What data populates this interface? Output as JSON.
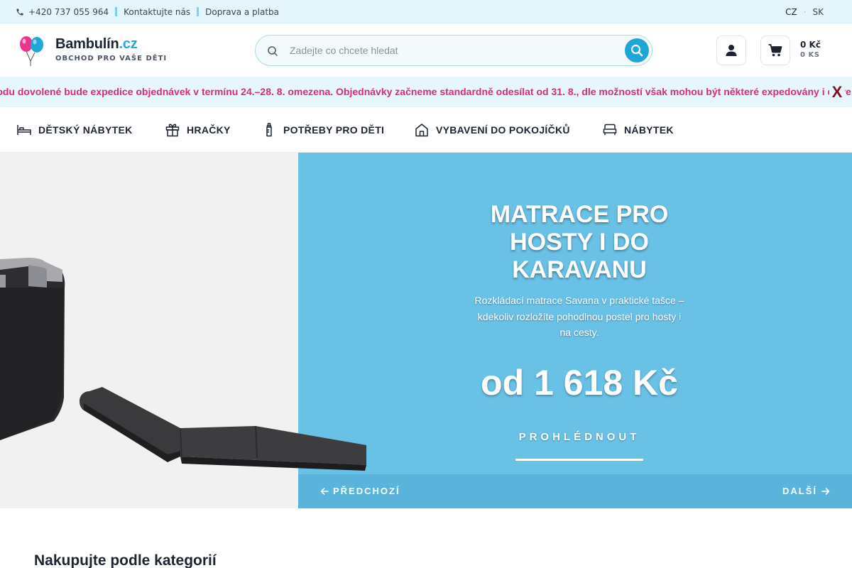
{
  "topbar": {
    "phone": "+420 737 055 964",
    "links": [
      "Kontaktujte nás",
      "Doprava a platba"
    ],
    "languages": [
      "CZ",
      "SK"
    ]
  },
  "header": {
    "logo_name": "Bambulín",
    "logo_tld": ".cz",
    "logo_tagline": "OBCHOD PRO VAŠE DĚTI",
    "search_placeholder": "Zadejte co chcete hledat",
    "cart_price": "0 Kč",
    "cart_count": "0 KS"
  },
  "notice": {
    "text": "Z důvodu dovolené bude expedice objednávek v termínu 24.–28. 8. omezena. Objednávky začneme standardně odesílat od 31. 8., dle možností však mohou být některé expedovány i dříve.",
    "close_label": "X"
  },
  "nav": {
    "items": [
      {
        "label": "DĚTSKÝ NÁBYTEK",
        "icon": "bed-icon"
      },
      {
        "label": "HRAČKY",
        "icon": "gift-icon"
      },
      {
        "label": "POTŘEBY PRO DĚTI",
        "icon": "bottle-icon"
      },
      {
        "label": "VYBAVENÍ DO POKOJÍČKŮ",
        "icon": "house-icon"
      },
      {
        "label": "NÁBYTEK",
        "icon": "sofa-icon"
      }
    ]
  },
  "hero": {
    "title": "MATRACE PRO HOSTY I DO KARAVANU",
    "description": "Rozkládací matrace Savana v praktické tašce – kdekoliv rozložíte pohodlnou postel pro hosty i na cesty.",
    "price": "od 1 618 Kč",
    "cta": "PROHLÉDNOUT",
    "prev": "PŘEDCHOZÍ",
    "next": "DALŠÍ"
  },
  "section": {
    "title": "Nakupujte podle kategorií"
  },
  "colors": {
    "accent": "#1ea6d6",
    "notice_text": "#d62c7a",
    "hero_bg": "#6ac1e6"
  }
}
